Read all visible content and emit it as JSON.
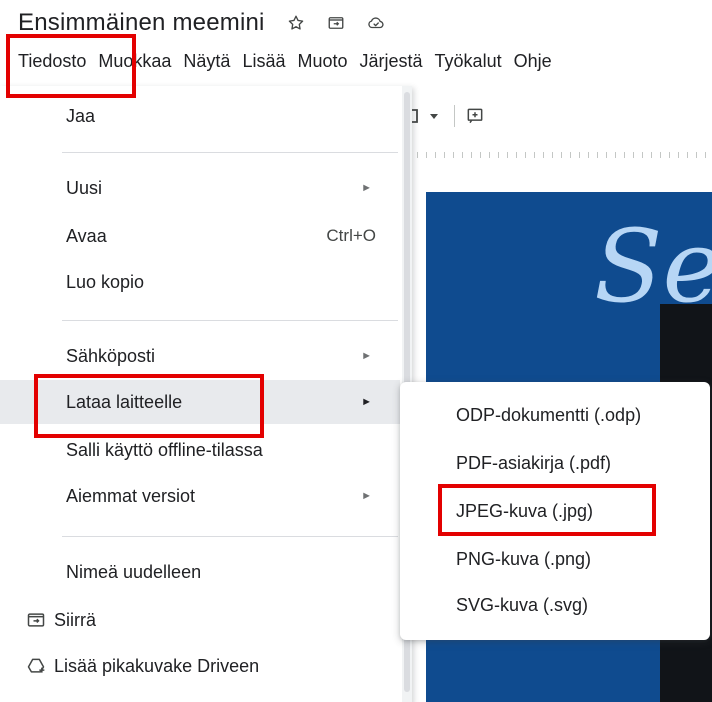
{
  "document": {
    "title": "Ensimmäinen meemini"
  },
  "title_icons": [
    "star-icon",
    "move-to-folder-icon",
    "cloud-saved-icon"
  ],
  "menubar": {
    "items": [
      "Tiedosto",
      "Muokkaa",
      "Näytä",
      "Lisää",
      "Muoto",
      "Järjestä",
      "Työkalut",
      "Ohje"
    ]
  },
  "slide": {
    "visible_text": "Se",
    "background_color": "#0f4b8f",
    "text_color": "#b7d6f5"
  },
  "file_menu": {
    "items": [
      {
        "label": "Jaa"
      },
      {
        "label": "Uusi",
        "has_submenu": true
      },
      {
        "label": "Avaa",
        "shortcut": "Ctrl+O"
      },
      {
        "label": "Luo kopio"
      },
      {
        "label": "Sähköposti",
        "has_submenu": true
      },
      {
        "label": "Lataa laitteelle",
        "has_submenu": true,
        "highlighted": true
      },
      {
        "label": "Salli käyttö offline-tilassa"
      },
      {
        "label": "Aiemmat versiot",
        "has_submenu": true
      },
      {
        "label": "Nimeä uudelleen"
      },
      {
        "label": "Siirrä",
        "icon": "move-folder-icon"
      },
      {
        "label": "Lisää pikakuvake Driveen",
        "icon": "drive-shortcut-icon"
      }
    ],
    "submenu_arrow": "►"
  },
  "download_submenu": {
    "items": [
      {
        "label": "ODP-dokumentti (.odp)"
      },
      {
        "label": "PDF-asiakirja (.pdf)"
      },
      {
        "label": "JPEG-kuva (.jpg)"
      },
      {
        "label": "PNG-kuva (.png)"
      },
      {
        "label": "SVG-kuva (.svg)"
      }
    ]
  },
  "annotation_color": "#e30000"
}
